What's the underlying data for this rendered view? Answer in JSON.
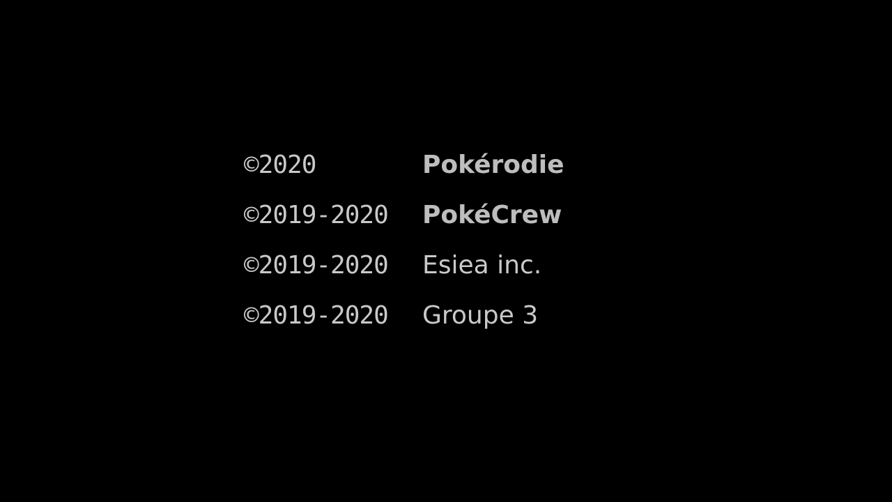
{
  "credits": [
    {
      "year": "©2020",
      "holder": "Pokérodie"
    },
    {
      "year": "©2019-2020",
      "holder": "PokéCrew"
    },
    {
      "year": "©2019-2020",
      "holder": "Esiea inc."
    },
    {
      "year": "©2019-2020",
      "holder": "Groupe 3"
    }
  ],
  "colors": {
    "background": "#000000",
    "text": "#c9c9c9"
  }
}
